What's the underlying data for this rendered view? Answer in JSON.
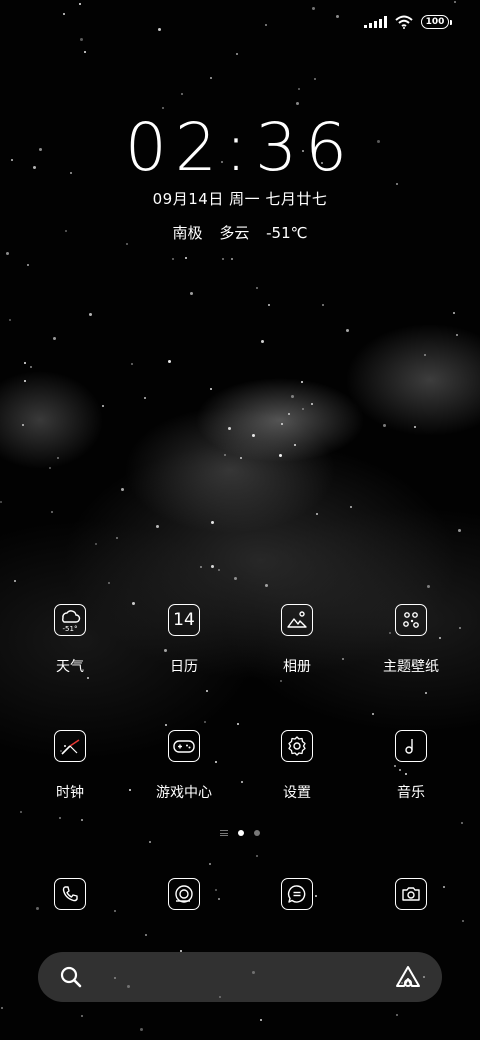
{
  "status_bar": {
    "battery_level": "100"
  },
  "lockscreen": {
    "time": "02:36",
    "date": "09月14日 周一 七月廿七",
    "weather": {
      "location": "南极",
      "condition": "多云",
      "temperature": "-51℃"
    }
  },
  "apps": {
    "row1": [
      {
        "label": "天气",
        "icon": "weather-icon",
        "icon_text": "-51°"
      },
      {
        "label": "日历",
        "icon": "calendar-icon",
        "icon_text": "14"
      },
      {
        "label": "相册",
        "icon": "gallery-icon"
      },
      {
        "label": "主题壁纸",
        "icon": "themes-icon"
      }
    ],
    "row2": [
      {
        "label": "时钟",
        "icon": "clock-icon"
      },
      {
        "label": "游戏中心",
        "icon": "gamepad-icon"
      },
      {
        "label": "设置",
        "icon": "gear-icon"
      },
      {
        "label": "音乐",
        "icon": "music-note-icon"
      }
    ]
  },
  "dock": [
    {
      "icon": "phone-icon"
    },
    {
      "icon": "browser-icon"
    },
    {
      "icon": "messages-icon"
    },
    {
      "icon": "camera-icon"
    }
  ],
  "page_indicator": {
    "pages": 2,
    "active": 1
  },
  "search_bar": {
    "left_icon": "search-icon",
    "right_icon": "assistant-icon"
  },
  "colors": {
    "background": "#000000",
    "foreground": "#ffffff",
    "search_bar": "#5a5a5a"
  }
}
